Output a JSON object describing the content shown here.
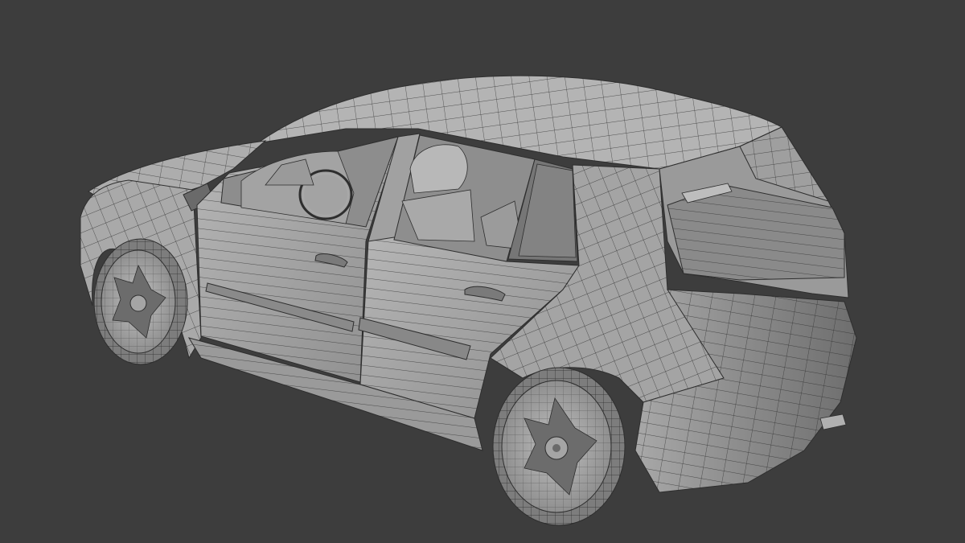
{
  "viewport": {
    "background": "#3d3d3d",
    "subject": "car-wireframe",
    "colors": {
      "surface_light": "#b4b4b4",
      "surface_mid": "#9c9c9c",
      "surface_dark": "#7c7c7c",
      "surface_shadow": "#676767",
      "wire": "#2e2e2e"
    }
  }
}
